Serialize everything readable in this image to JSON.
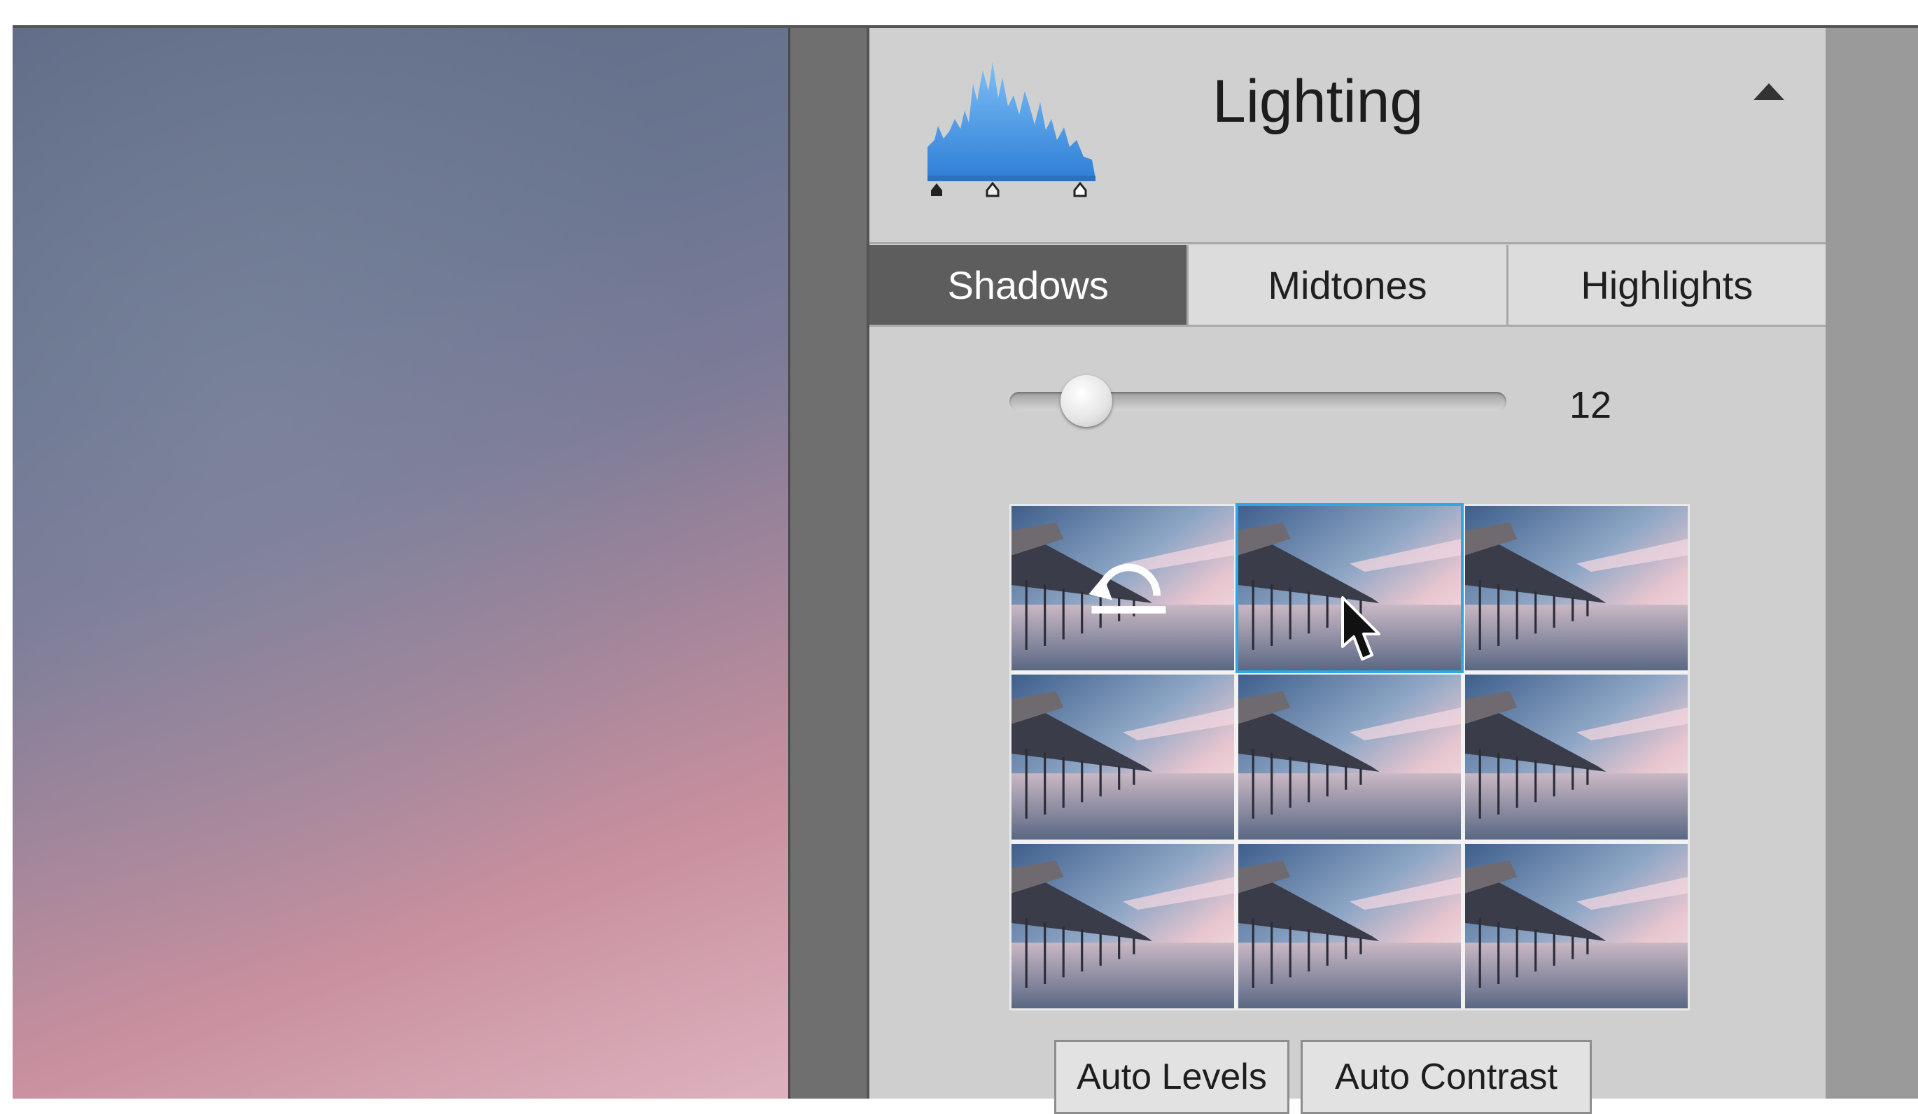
{
  "panel": {
    "title": "Lighting",
    "icons": {
      "histogram": "histogram-icon",
      "collapse": "triangle-up-icon",
      "reset": "reset-icon",
      "cursor": "arrow-cursor-icon"
    },
    "accent_color": "#2ea6e8",
    "histogram_color": "#3e8fe0"
  },
  "tabs": [
    {
      "label": "Shadows",
      "active": true
    },
    {
      "label": "Midtones",
      "active": false
    },
    {
      "label": "Highlights",
      "active": false
    }
  ],
  "slider": {
    "value": "12",
    "position_fraction": 0.155
  },
  "thumbnails": {
    "count": 9,
    "selected_index": 1,
    "reset_index": 0
  },
  "buttons": {
    "auto_levels": "Auto Levels",
    "auto_contrast": "Auto Contrast"
  }
}
